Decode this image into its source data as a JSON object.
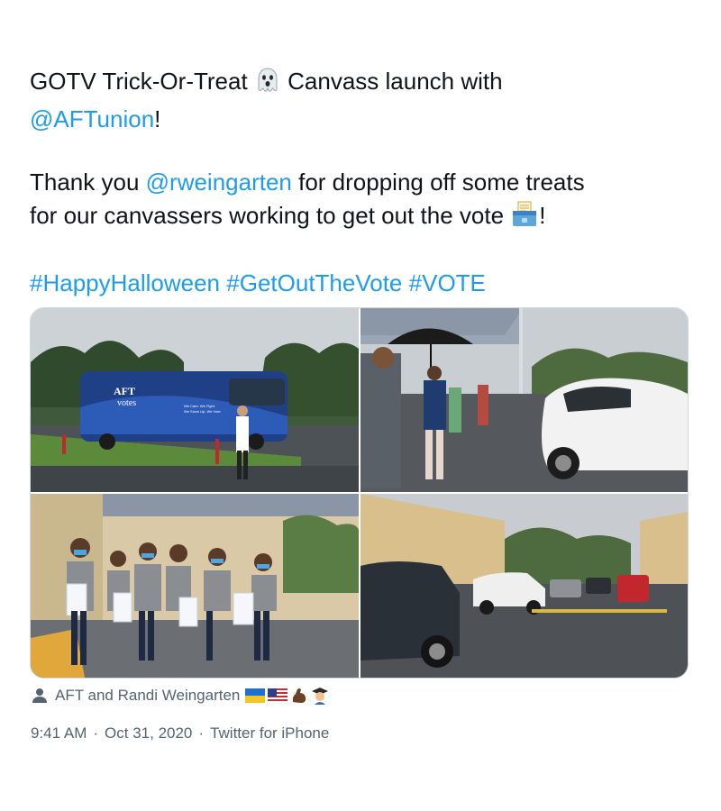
{
  "tweet": {
    "line1_a": "GOTV Trick-Or-Treat ",
    "line1_emoji": "ghost-emoji",
    "line1_b": " Canvass launch with",
    "mention1": "@AFTunion",
    "line2_end": "!",
    "thanks_a": "Thank you ",
    "mention2": "@rweingarten",
    "thanks_b": " for dropping off some treats",
    "thanks_c": "for our canvassers working to get out the vote ",
    "ballot_emoji": "ballot-box-emoji",
    "thanks_end": "!",
    "hashtags": [
      "#HappyHalloween",
      "#GetOutTheVote",
      "#VOTE"
    ]
  },
  "media": {
    "photos": [
      {
        "name": "photo-bus",
        "bus_text_1": "AFT",
        "bus_text_2": "votes",
        "bus_slogan_1": "We Care. We Fight.",
        "bus_slogan_2": "We Show Up. We Vote."
      },
      {
        "name": "photo-canvassers-umbrella"
      },
      {
        "name": "photo-volunteers-with-bags"
      },
      {
        "name": "photo-cars-in-rain"
      }
    ]
  },
  "tagged": {
    "icon": "person-icon",
    "text": "AFT and Randi Weingarten",
    "emojis": [
      "ukraine-flag-emoji",
      "us-flag-emoji",
      "flexed-biceps-emoji",
      "teacher-emoji"
    ]
  },
  "meta": {
    "time": "9:41 AM",
    "separator": "·",
    "date": "Oct 31, 2020",
    "source": "Twitter for iPhone"
  },
  "colors": {
    "link": "#1d9bf0",
    "text": "#0f1419",
    "secondary": "#536471",
    "border": "#cfd9de"
  }
}
